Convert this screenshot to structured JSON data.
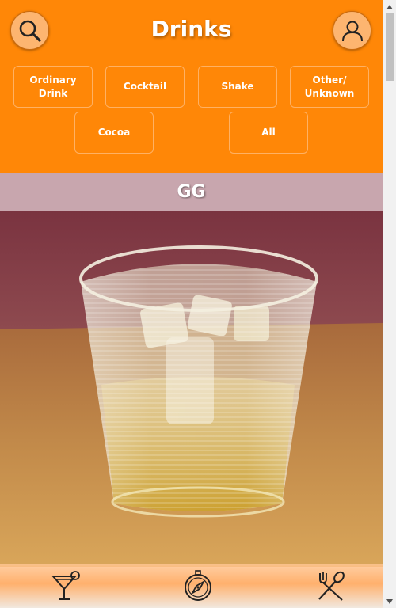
{
  "header": {
    "title": "Drinks",
    "search_icon": "search-icon",
    "profile_icon": "user-icon",
    "accent_color": "#ff8707"
  },
  "categories": [
    {
      "label": "Ordinary Drink"
    },
    {
      "label": "Cocktail"
    },
    {
      "label": "Shake"
    },
    {
      "label": "Other/ Unknown"
    },
    {
      "label": "Cocoa"
    },
    {
      "label": "All"
    }
  ],
  "drink": {
    "name": "GG",
    "image_icon": "drink-photo"
  },
  "bottom_nav": {
    "items": [
      {
        "icon": "cocktail-glass-icon"
      },
      {
        "icon": "compass-icon"
      },
      {
        "icon": "fork-spoon-icon"
      }
    ]
  }
}
